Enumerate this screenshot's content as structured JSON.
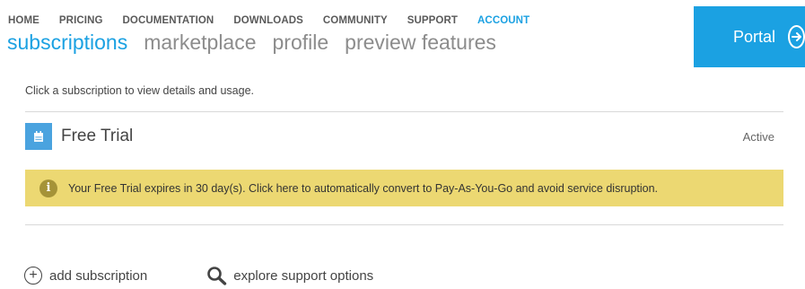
{
  "nav": {
    "items": [
      "HOME",
      "PRICING",
      "DOCUMENTATION",
      "DOWNLOADS",
      "COMMUNITY",
      "SUPPORT",
      "ACCOUNT"
    ],
    "active": "ACCOUNT"
  },
  "tabs": {
    "items": [
      "subscriptions",
      "marketplace",
      "profile",
      "preview features"
    ],
    "active": "subscriptions"
  },
  "portal": {
    "label": "Portal",
    "icon": "arrow-right-circle-icon"
  },
  "hint": "Click a subscription to view details and usage.",
  "subscription": {
    "icon": "subscription-icon",
    "name": "Free Trial",
    "status": "Active"
  },
  "banner": {
    "icon": "info-icon",
    "message": "Your Free Trial expires in 30 day(s). Click here to automatically convert to Pay-As-You-Go and avoid service disruption."
  },
  "actions": {
    "add_subscription": "add subscription",
    "explore_support": "explore support options"
  },
  "colors": {
    "accent": "#1ba1e2",
    "banner": "#ecd872",
    "banner_icon": "#a59338"
  }
}
